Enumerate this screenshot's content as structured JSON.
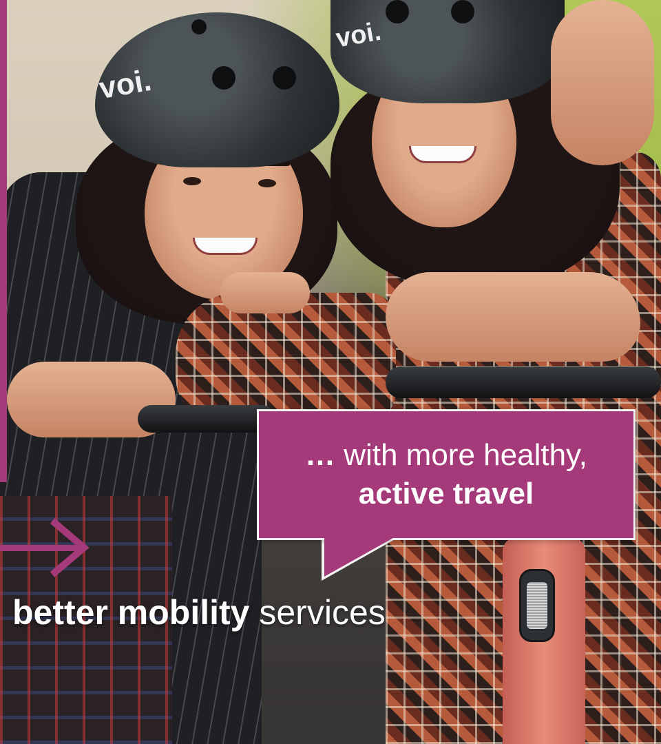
{
  "bubble": {
    "ellipsis": "…",
    "line1": " with more healthy,",
    "line2": "active travel"
  },
  "caption": {
    "bold": "better mobility",
    "light": " services"
  },
  "photo": {
    "helmet_brand_left": "voi.",
    "helmet_brand_right": "voi."
  },
  "colors": {
    "accent": "#a53a7b",
    "bubble_border": "#f4f4f4",
    "text": "#ffffff"
  },
  "icons": [
    "arrow-right-icon"
  ]
}
